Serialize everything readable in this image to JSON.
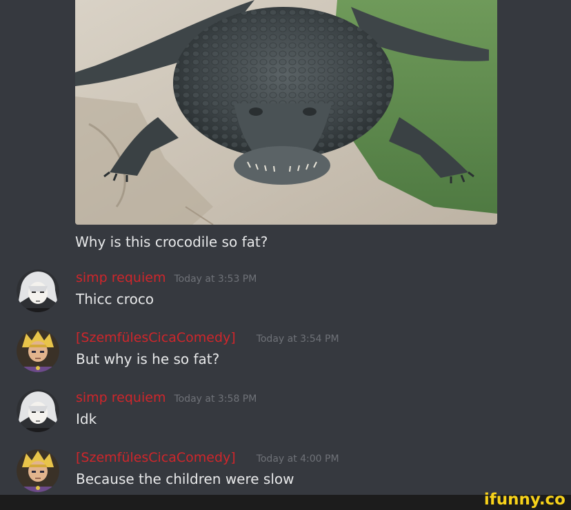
{
  "post": {
    "caption": "Why is this crocodile so fat?"
  },
  "messages": [
    {
      "username": "simp requiem",
      "timestamp": "Today at 3:53 PM",
      "text": "Thicc croco",
      "avatar": "white-haired-anime-avatar"
    },
    {
      "username": "[SzemfülesCicaComedy]",
      "timestamp": "Today at 3:54 PM",
      "text": "But why is he so fat?",
      "avatar": "blonde-anime-avatar"
    },
    {
      "username": "simp requiem",
      "timestamp": "Today at 3:58 PM",
      "text": "Idk",
      "avatar": "white-haired-anime-avatar"
    },
    {
      "username": "[SzemfülesCicaComedy]",
      "timestamp": "Today at 4:00 PM",
      "text": "Because the children were slow",
      "avatar": "blonde-anime-avatar"
    }
  ],
  "watermark": "ifunny.co",
  "colors": {
    "background": "#36393f",
    "username": "#d0262b",
    "timestamp": "#6f7278",
    "text": "#e8e9ea",
    "watermark": "#f7d21a"
  }
}
